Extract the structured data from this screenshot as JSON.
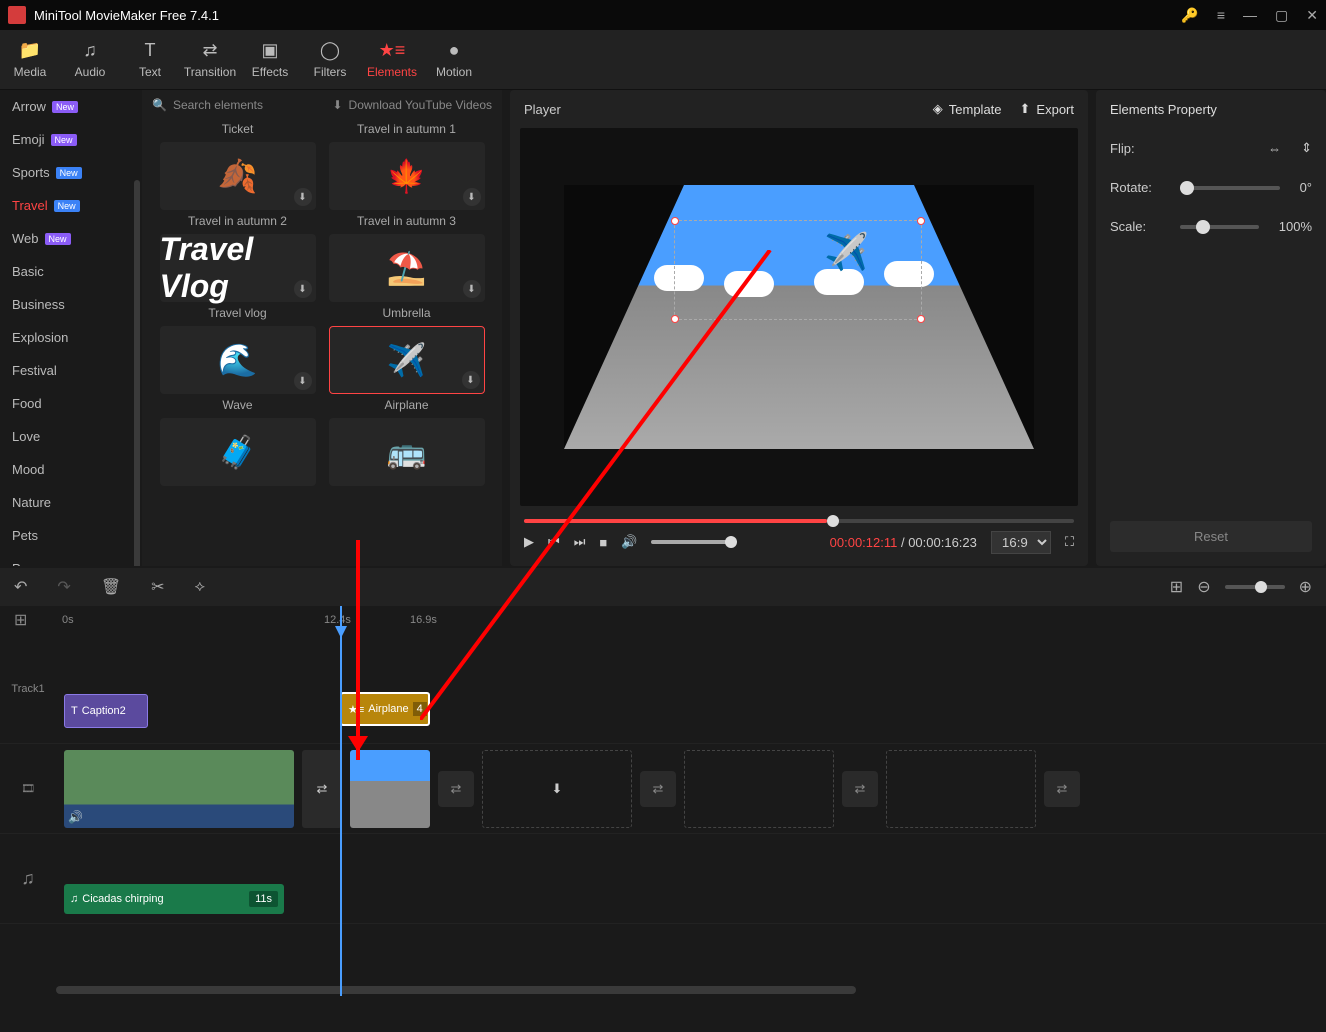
{
  "app": {
    "title": "MiniTool MovieMaker Free 7.4.1"
  },
  "toolbar": {
    "media": "Media",
    "audio": "Audio",
    "text": "Text",
    "transition": "Transition",
    "effects": "Effects",
    "filters": "Filters",
    "elements": "Elements",
    "motion": "Motion"
  },
  "sidebar": {
    "items": [
      {
        "label": "Arrow",
        "badge": "New",
        "badgeClass": "new"
      },
      {
        "label": "Emoji",
        "badge": "New",
        "badgeClass": "new"
      },
      {
        "label": "Sports",
        "badge": "New",
        "badgeClass": "new2"
      },
      {
        "label": "Travel",
        "badge": "New",
        "badgeClass": "new2",
        "active": true
      },
      {
        "label": "Web",
        "badge": "New",
        "badgeClass": "new"
      },
      {
        "label": "Basic"
      },
      {
        "label": "Business"
      },
      {
        "label": "Explosion"
      },
      {
        "label": "Festival"
      },
      {
        "label": "Food"
      },
      {
        "label": "Love"
      },
      {
        "label": "Mood"
      },
      {
        "label": "Nature"
      },
      {
        "label": "Pets"
      },
      {
        "label": "Props"
      }
    ]
  },
  "elements": {
    "search_placeholder": "Search elements",
    "download_label": "Download YouTube Videos",
    "items": [
      {
        "label": "Ticket"
      },
      {
        "label": "Travel in autumn 1"
      },
      {
        "label": "Travel in autumn 2"
      },
      {
        "label": "Travel in autumn 3"
      },
      {
        "label": "Travel vlog"
      },
      {
        "label": "Umbrella"
      },
      {
        "label": "Wave"
      },
      {
        "label": "Airplane",
        "selected": true
      },
      {
        "label": ""
      },
      {
        "label": ""
      }
    ]
  },
  "player": {
    "title": "Player",
    "template": "Template",
    "export": "Export",
    "current_time": "00:00:12:11",
    "total_time": "00:00:16:23",
    "aspect": "16:9"
  },
  "props": {
    "title": "Elements Property",
    "flip": "Flip:",
    "rotate": "Rotate:",
    "scale": "Scale:",
    "rotate_val": "0°",
    "scale_val": "100%",
    "reset": "Reset"
  },
  "timeline": {
    "t0": "0s",
    "t1": "12.4s",
    "t2": "16.9s",
    "track1": "Track1",
    "caption_label": "Caption2",
    "airplane_label": "Airplane",
    "airplane_dur": "4",
    "audio_label": "Cicadas chirping",
    "audio_dur": "11s"
  }
}
